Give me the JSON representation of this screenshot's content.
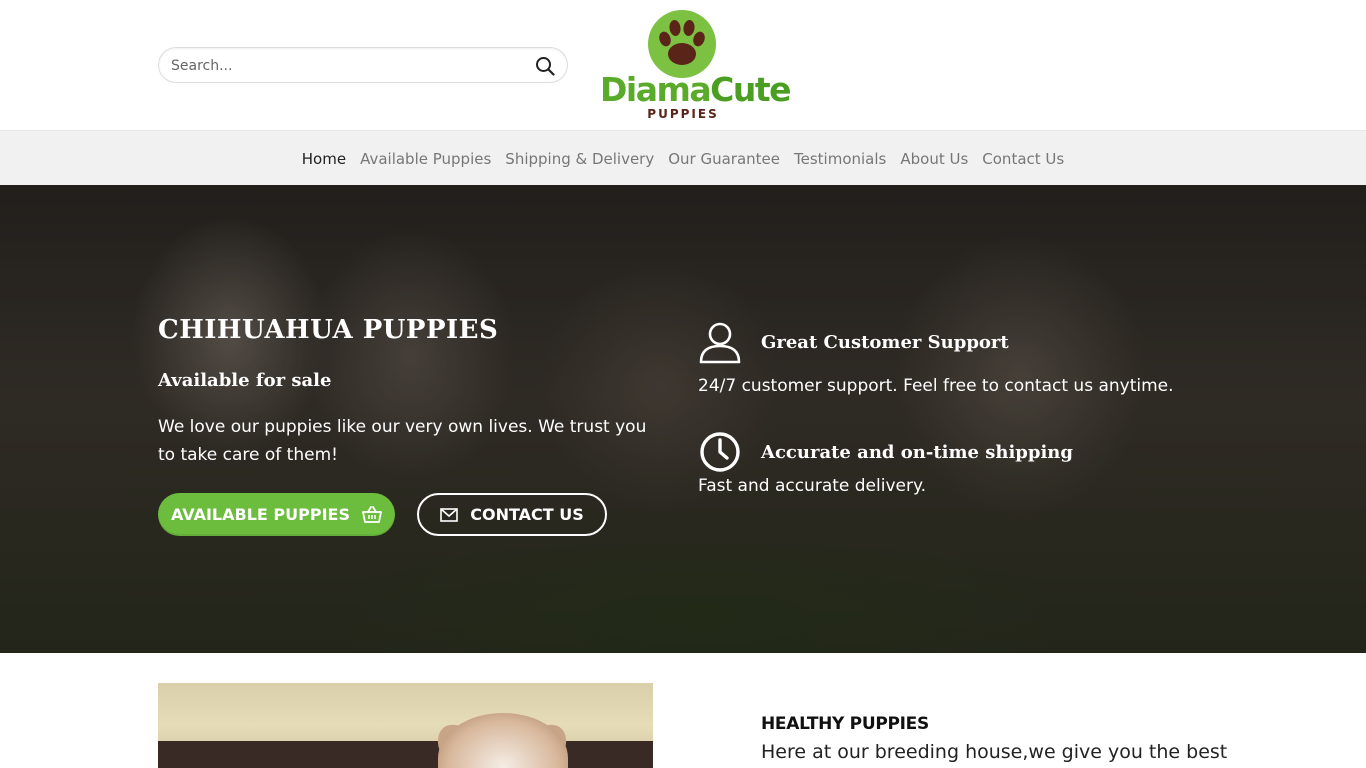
{
  "search": {
    "placeholder": "Search..."
  },
  "logo": {
    "brand_part1": "Diama",
    "brand_part2": "Cute",
    "subtitle": "PUPPIES",
    "brand_color": "#5aab2a",
    "paw_color": "#5a2418"
  },
  "nav": {
    "items": [
      {
        "label": "Home",
        "active": true
      },
      {
        "label": "Available Puppies"
      },
      {
        "label": "Shipping & Delivery"
      },
      {
        "label": "Our Guarantee"
      },
      {
        "label": "Testimonials"
      },
      {
        "label": "About Us"
      },
      {
        "label": "Contact Us"
      }
    ]
  },
  "hero": {
    "title": "CHIHUAHUA PUPPIES",
    "subtitle": "Available for sale",
    "lead": "We love our puppies like our very own lives. We trust you to take care of them!",
    "primary_button": {
      "label": "AVAILABLE PUPPIES",
      "icon": "basket-icon",
      "color": "#6cbd3d"
    },
    "secondary_button": {
      "label": "CONTACT US",
      "icon": "envelope-icon"
    },
    "features": [
      {
        "icon": "user-icon",
        "title": "Great Customer Support",
        "description": "24/7 customer support. Feel free to contact us anytime."
      },
      {
        "icon": "clock-icon",
        "title": "Accurate and on-time shipping",
        "description": "Fast and accurate delivery."
      }
    ]
  },
  "section": {
    "title": "HEALTHY PUPPIES",
    "text": "Here at our breeding house,we give you the best"
  }
}
